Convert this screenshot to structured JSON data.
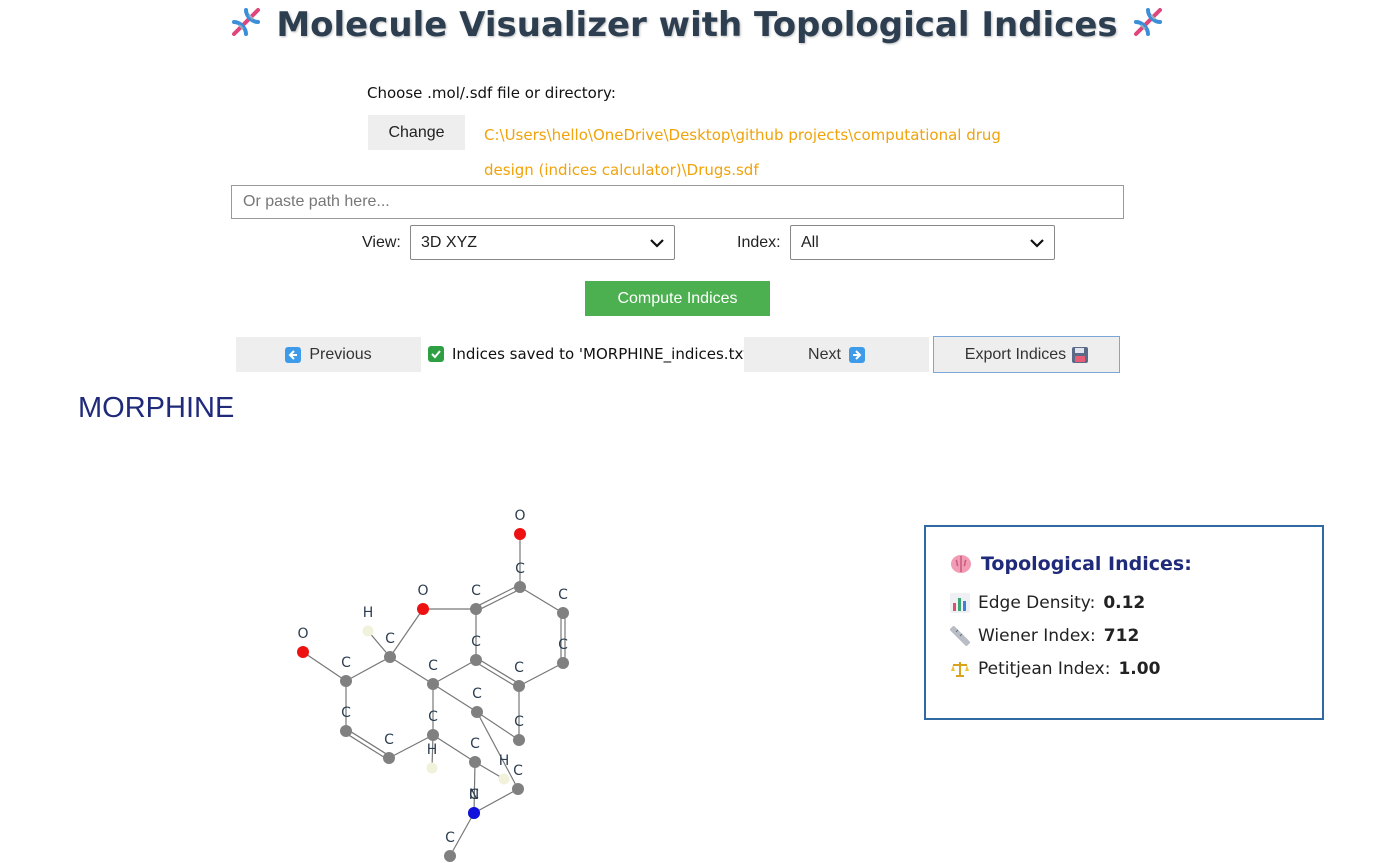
{
  "header": {
    "title": "Molecule Visualizer with Topological Indices",
    "emoji_icon": "dna-icon"
  },
  "file_chooser": {
    "label": "Choose .mol/.sdf file or directory:",
    "change_label": "Change",
    "selected_path": "C:\\Users\\hello\\OneDrive\\Desktop\\github projects\\computational drug design (indices calculator)\\Drugs.sdf",
    "path_color": "#f0a30a"
  },
  "path_input": {
    "placeholder": "Or paste path here...",
    "value": ""
  },
  "view": {
    "label": "View:",
    "selected": "3D XYZ"
  },
  "index": {
    "label": "Index:",
    "selected": "All"
  },
  "compute": {
    "label": "Compute Indices",
    "color": "#4caf50"
  },
  "navigation": {
    "previous_label": "Previous",
    "next_label": "Next",
    "export_label": "Export Indices",
    "status_text": "Indices saved to 'MORPHINE_indices.txt'"
  },
  "molecule": {
    "name": "MORPHINE",
    "atom_colors": {
      "C": "#808080",
      "O": "#ee1111",
      "N": "#1111dd",
      "H": "#f2f2dc"
    },
    "atoms": [
      {
        "el": "O",
        "label": "O"
      },
      {
        "el": "C",
        "label": "C"
      },
      {
        "el": "C",
        "label": "C"
      },
      {
        "el": "C",
        "label": "C"
      },
      {
        "el": "C",
        "label": "C"
      },
      {
        "el": "C",
        "label": "C"
      },
      {
        "el": "O",
        "label": "O"
      },
      {
        "el": "C",
        "label": "C"
      },
      {
        "el": "C",
        "label": "C"
      },
      {
        "el": "C",
        "label": "C"
      },
      {
        "el": "C",
        "label": "C"
      },
      {
        "el": "H",
        "label": "H"
      },
      {
        "el": "O",
        "label": "O"
      },
      {
        "el": "C",
        "label": "C"
      },
      {
        "el": "C",
        "label": "C"
      },
      {
        "el": "C",
        "label": "C"
      },
      {
        "el": "C",
        "label": "C"
      },
      {
        "el": "C",
        "label": "C"
      },
      {
        "el": "C",
        "label": "C"
      },
      {
        "el": "H",
        "label": "H"
      },
      {
        "el": "C",
        "label": "C"
      },
      {
        "el": "H",
        "label": "H"
      },
      {
        "el": "C",
        "label": "C"
      },
      {
        "el": "N",
        "label": "N"
      },
      {
        "el": "C",
        "label": "C"
      }
    ]
  },
  "indices": {
    "title": "Topological Indices:",
    "items": [
      {
        "label": "Edge Density:",
        "value": "0.12",
        "icon": "bar-chart-icon"
      },
      {
        "label": "Wiener Index:",
        "value": "712",
        "icon": "ruler-icon"
      },
      {
        "label": "Petitjean Index:",
        "value": "1.00",
        "icon": "balance-scale-icon"
      }
    ]
  }
}
